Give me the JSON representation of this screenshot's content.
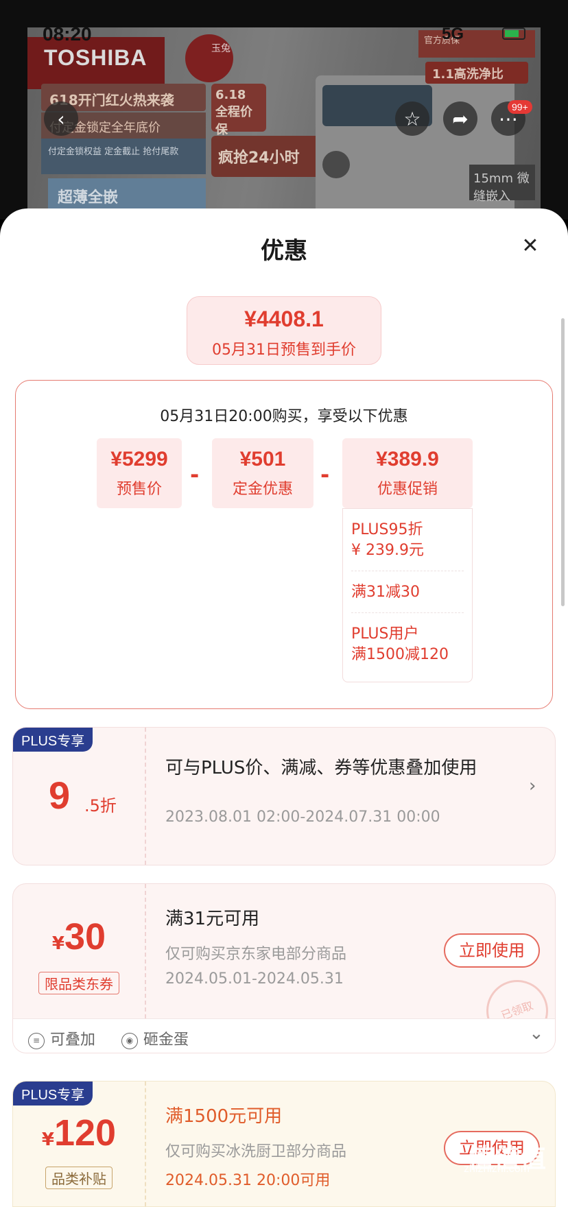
{
  "status": {
    "time": "08:20",
    "network": "5G"
  },
  "hero": {
    "brand": "TOSHIBA",
    "rabbit_text": "玉兔",
    "promo_lines": [
      "618开门红火热来袭",
      "付定金锁定全年底价",
      "付定金锁权益 定金截止 抢付尾款",
      "超薄全嵌"
    ],
    "price_tag": "6.18 全程价保",
    "rush_text": "疯抢24小时",
    "right_tags": [
      "官方质保",
      "1.1高洗净比",
      "15mm 微缝嵌入"
    ],
    "more_badge": "99+"
  },
  "sheet": {
    "title": "优惠",
    "final_price": "¥4408.1",
    "final_label": "05月31日预售到手价",
    "breakdown_head": "05月31日20:00购买，享受以下优惠",
    "items": [
      {
        "value": "¥5299",
        "label": "预售价"
      },
      {
        "value": "¥501",
        "label": "定金优惠"
      },
      {
        "value": "¥389.9",
        "label": "优惠促销"
      }
    ],
    "minus": "-",
    "promos": [
      "PLUS95折\n¥ 239.9元",
      "满31减30",
      "PLUS用户\n满1500减120"
    ]
  },
  "cards": {
    "plus_tag": "PLUS专享",
    "card1": {
      "disc_big": "9",
      "disc_small": ".5折",
      "title": "可与PLUS价、满减、券等优惠叠加使用",
      "date": "2023.08.01 02:00-2024.07.31 00:00",
      "chevron": "›"
    },
    "card2": {
      "currency": "¥",
      "amount": "30",
      "category": "限品类东券",
      "title": "满31元可用",
      "scope": "仅可购买京东家电部分商品",
      "date": "2024.05.01-2024.05.31",
      "button": "立即使用",
      "stamp": "已领取",
      "foot1": "可叠加",
      "foot2": "砸金蛋",
      "foot_chevron": "⌄"
    },
    "card3": {
      "currency": "¥",
      "amount": "120",
      "category": "品类补贴",
      "title": "满1500元可用",
      "scope": "仅可购买冰洗厨卫部分商品",
      "date": "2024.05.31 20:00可用",
      "button": "立即使用"
    }
  },
  "watermark": {
    "logo": "值值值",
    "url": "zhizhizhi.com"
  }
}
